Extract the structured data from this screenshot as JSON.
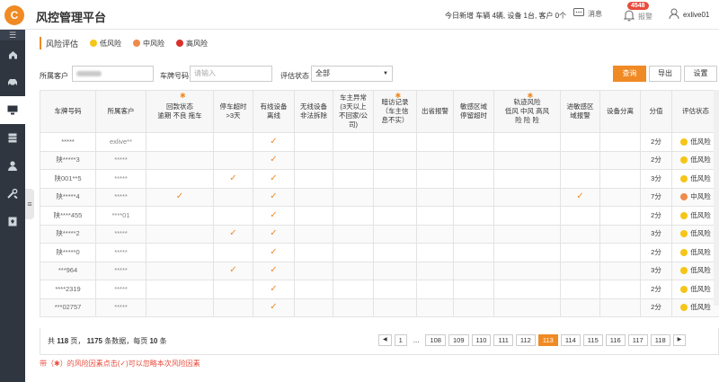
{
  "app": {
    "logo_text": "C",
    "title": "风控管理平台"
  },
  "header": {
    "today_stats": "今日新增  车辆 4辆, 设备 1台, 客户 0个",
    "messages_label": "消息",
    "alarm_badge": "4548",
    "alarm_label": "报警",
    "username": "exlive01"
  },
  "sidebar": {
    "toggle_icon": "menu-icon",
    "items": [
      {
        "icon": "home-icon",
        "active": false
      },
      {
        "icon": "car-icon",
        "active": false
      },
      {
        "icon": "monitor-icon",
        "active": true
      },
      {
        "icon": "database-icon",
        "active": false
      },
      {
        "icon": "user-icon",
        "active": false
      },
      {
        "icon": "tools-icon",
        "active": false
      },
      {
        "icon": "document-icon",
        "active": false
      }
    ]
  },
  "section": {
    "title": "风险评估",
    "legend": [
      {
        "label": "低风险",
        "color": "#f5c518"
      },
      {
        "label": "中风险",
        "color": "#f08a4b"
      },
      {
        "label": "高风险",
        "color": "#d9302c"
      }
    ]
  },
  "filters": {
    "customer_label": "所属客户",
    "plate_label": "车牌号码",
    "plate_placeholder": "请输入",
    "status_label": "评估状态",
    "status_value": "全部",
    "query_button": "查询",
    "export_button": "导出",
    "settings_button": "设置"
  },
  "table": {
    "headers": [
      {
        "label": "车牌号码",
        "star": false
      },
      {
        "label": "所属客户",
        "star": false
      },
      {
        "label": "回款状态\n逾期  不良  拖车",
        "star": true
      },
      {
        "label": "停车超时\n>3天",
        "star": false
      },
      {
        "label": "有线设备\n离线",
        "star": false
      },
      {
        "label": "无线设备\n非法拆除",
        "star": false
      },
      {
        "label": "车主异常\n(3天以上\n不回家/公\n司)",
        "star": false
      },
      {
        "label": "暗访记录\n（车主信\n息不实）",
        "star": true
      },
      {
        "label": "出省报警",
        "star": false
      },
      {
        "label": "敏感区域\n停留超时",
        "star": false
      },
      {
        "label": "轨迹风险\n低风    中风    高风\n险      险      险",
        "star": true
      },
      {
        "label": "进敏感区\n域报警",
        "star": false
      },
      {
        "label": "设备分离",
        "star": false
      },
      {
        "label": "分值",
        "star": false
      },
      {
        "label": "评估状态",
        "star": false
      }
    ],
    "rows": [
      {
        "plate": "*****",
        "customer": "exlive**",
        "checks": [
          4
        ],
        "score": "2分",
        "risk": "低风险",
        "risk_color": "#f5c518"
      },
      {
        "plate": "陕*****3",
        "customer": "*****",
        "checks": [
          4
        ],
        "score": "2分",
        "risk": "低风险",
        "risk_color": "#f5c518"
      },
      {
        "plate": "陕001**5",
        "customer": "*****",
        "checks": [
          3,
          4
        ],
        "score": "3分",
        "risk": "低风险",
        "risk_color": "#f5c518"
      },
      {
        "plate": "陕*****4",
        "customer": "*****",
        "checks": [
          2,
          4,
          11
        ],
        "score": "7分",
        "risk": "中风险",
        "risk_color": "#f08a4b"
      },
      {
        "plate": "陕****455",
        "customer": "****01",
        "checks": [
          4
        ],
        "score": "2分",
        "risk": "低风险",
        "risk_color": "#f5c518"
      },
      {
        "plate": "陕*****2",
        "customer": "*****",
        "checks": [
          3,
          4
        ],
        "score": "3分",
        "risk": "低风险",
        "risk_color": "#f5c518"
      },
      {
        "plate": "陕*****0",
        "customer": "*****",
        "checks": [
          4
        ],
        "score": "2分",
        "risk": "低风险",
        "risk_color": "#f5c518"
      },
      {
        "plate": "***964",
        "customer": "*****",
        "checks": [
          3,
          4
        ],
        "score": "3分",
        "risk": "低风险",
        "risk_color": "#f5c518"
      },
      {
        "plate": "****2319",
        "customer": "*****",
        "checks": [
          4
        ],
        "score": "2分",
        "risk": "低风险",
        "risk_color": "#f5c518"
      },
      {
        "plate": "***02757",
        "customer": "*****",
        "checks": [
          4
        ],
        "score": "2分",
        "risk": "低风险",
        "risk_color": "#f5c518"
      }
    ],
    "check_glyph": "✓"
  },
  "pagination": {
    "total_prefix": "共",
    "total_pages": "118",
    "pages_unit": "页，",
    "total_records": "1175",
    "records_unit": "条数据，每页",
    "per_page": "10",
    "per_page_unit": "条",
    "first": "1",
    "ellipsis": "...",
    "pages": [
      "108",
      "109",
      "110",
      "111",
      "112",
      "113",
      "114",
      "115",
      "116",
      "117",
      "118"
    ],
    "current": "113"
  },
  "note": "带（✱）的风险因素点击(✓)可以忽略本次风险因素"
}
